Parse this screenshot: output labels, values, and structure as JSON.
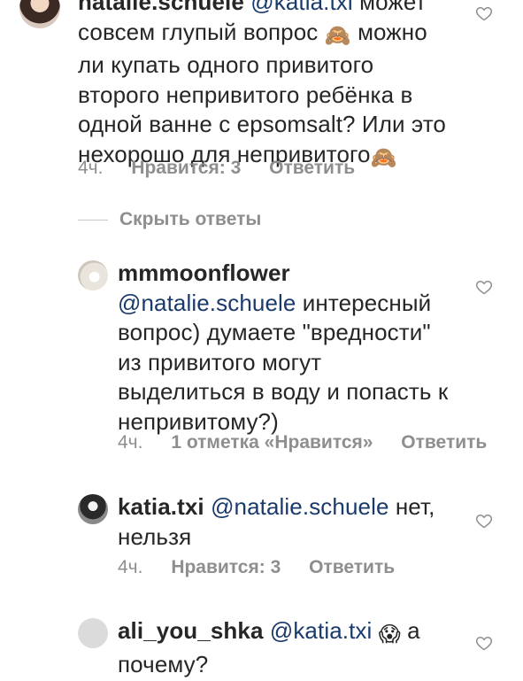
{
  "comments": [
    {
      "username": "natalie.schuele",
      "mention": "@katia.txi",
      "text_lines": [
        "может",
        "совсем глупый вопрос",
        "можно",
        "ли купать одного привитого",
        "второго непривитого ребёнка в",
        "одной ванне с epsomsalt? Или это",
        "нехорошо для непривитого"
      ],
      "emoji": "🙈",
      "time": "4ч.",
      "likes": "Нравится: 3",
      "reply": "Ответить"
    },
    {
      "username": "mmmoonflower",
      "mention": "@natalie.schuele",
      "text_lines": [
        "интересный",
        "вопрос) думаете \"вредности\"",
        "из привитого могут",
        "выделиться в воду и попасть к",
        "непривитому?)"
      ],
      "time": "4ч.",
      "likes": "1 отметка «Нравится»",
      "reply": "Ответить"
    },
    {
      "username": "katia.txi",
      "mention": "@natalie.schuele",
      "text_lines": [
        "нет,",
        "нельзя"
      ],
      "time": "4ч.",
      "likes": "Нравится: 3",
      "reply": "Ответить"
    },
    {
      "username": "ali_you_shka",
      "mention": "@katia.txi",
      "emoji": "😱",
      "text_lines": [
        "а",
        "почему?"
      ]
    }
  ],
  "hide_replies": "Скрыть ответы",
  "colors": {
    "mention": "#1a3a6b",
    "meta": "#8e8e8e",
    "text": "#262626"
  }
}
